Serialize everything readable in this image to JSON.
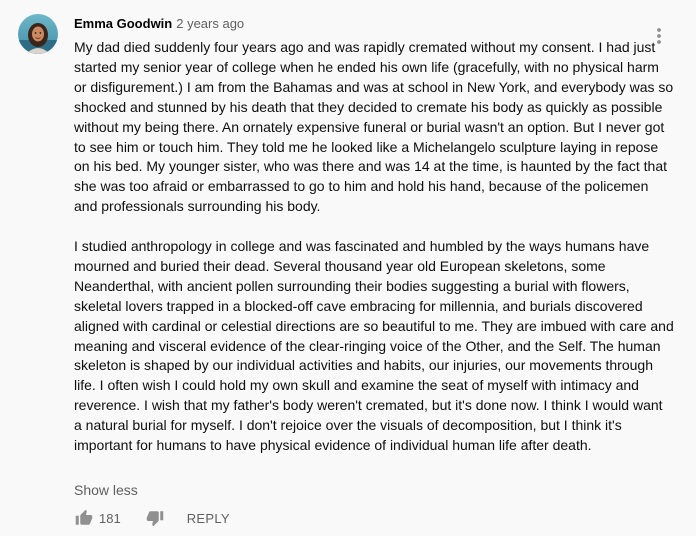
{
  "comment": {
    "author": "Emma Goodwin",
    "time": "2 years ago",
    "paragraphs": [
      "My dad died suddenly four years ago and was rapidly cremated without my consent. I had just started my senior year of college when he ended his own life (gracefully, with no physical harm or disfigurement.) I am from the Bahamas and was at school in New York, and everybody was so shocked and stunned by his death that they decided to cremate his body as quickly as possible without my being there. An ornately expensive funeral or burial wasn't an option. But I never got to see him or touch him. They told me he looked like a Michelangelo sculpture laying in repose on his bed. My younger sister, who was there and was 14 at the time, is haunted by the fact that she was too afraid or embarrassed to go to him and hold his hand, because of the policemen and professionals surrounding his body.",
      "I studied anthropology in college and was fascinated and humbled by the ways humans have mourned and buried their dead. Several thousand year old European skeletons, some Neanderthal, with ancient pollen surrounding their bodies suggesting a burial with flowers, skeletal lovers trapped in a blocked-off cave embracing for millennia, and burials discovered aligned with cardinal or celestial directions are so beautiful to me. They are imbued with care and meaning and visceral evidence of the clear-ringing voice of the Other, and the Self. The human skeleton is shaped by our individual activities and habits, our injuries, our movements through life. I often wish I could hold my own skull and examine the seat of myself with intimacy and reverence. I wish that my father's body weren't cremated, but it's done now. I think I would want a natural burial for myself. I don't rejoice over the visuals of decomposition, but I think it's important for humans to have physical evidence of individual human life after death."
    ],
    "show_less": "Show less",
    "likes": "181",
    "reply": "REPLY"
  },
  "icons": {
    "avatar": "avatar-photo",
    "menu": "more-vert-icon",
    "like": "thumb-up-icon",
    "dislike": "thumb-down-icon"
  },
  "colors": {
    "background": "#f9f9f9",
    "text": "#0f0f0f",
    "secondary_text": "#606060",
    "icon": "#909090"
  }
}
